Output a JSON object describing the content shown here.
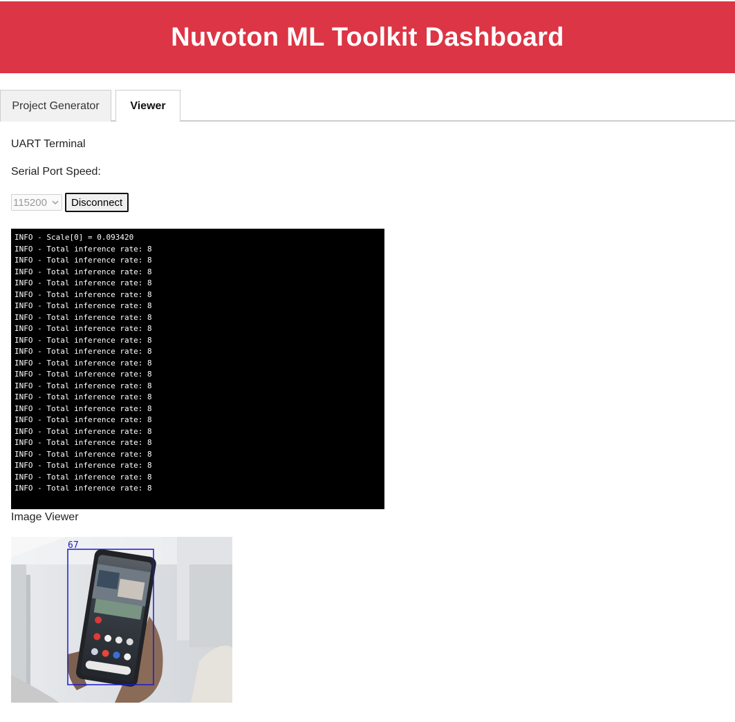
{
  "header": {
    "title": "Nuvoton ML Toolkit Dashboard",
    "color": "#dc3545"
  },
  "tabs": [
    {
      "label": "Project Generator",
      "active": false
    },
    {
      "label": "Viewer",
      "active": true
    }
  ],
  "uart": {
    "title": "UART Terminal",
    "speed_label": "Serial Port Speed:",
    "speed_value": "115200",
    "disconnect_label": "Disconnect",
    "lines": [
      "INFO - Scale[0] = 0.093420",
      "INFO - Total inference rate: 8",
      "INFO - Total inference rate: 8",
      "INFO - Total inference rate: 8",
      "INFO - Total inference rate: 8",
      "INFO - Total inference rate: 8",
      "INFO - Total inference rate: 8",
      "INFO - Total inference rate: 8",
      "INFO - Total inference rate: 8",
      "INFO - Total inference rate: 8",
      "INFO - Total inference rate: 8",
      "INFO - Total inference rate: 8",
      "INFO - Total inference rate: 8",
      "INFO - Total inference rate: 8",
      "INFO - Total inference rate: 8",
      "INFO - Total inference rate: 8",
      "INFO - Total inference rate: 8",
      "INFO - Total inference rate: 8",
      "INFO - Total inference rate: 8",
      "INFO - Total inference rate: 8",
      "INFO - Total inference rate: 8",
      "INFO - Total inference rate: 8",
      "INFO - Total inference rate: 8"
    ]
  },
  "image_viewer": {
    "title": "Image Viewer",
    "detection_label": "67",
    "box_color": "#1a1acc"
  }
}
